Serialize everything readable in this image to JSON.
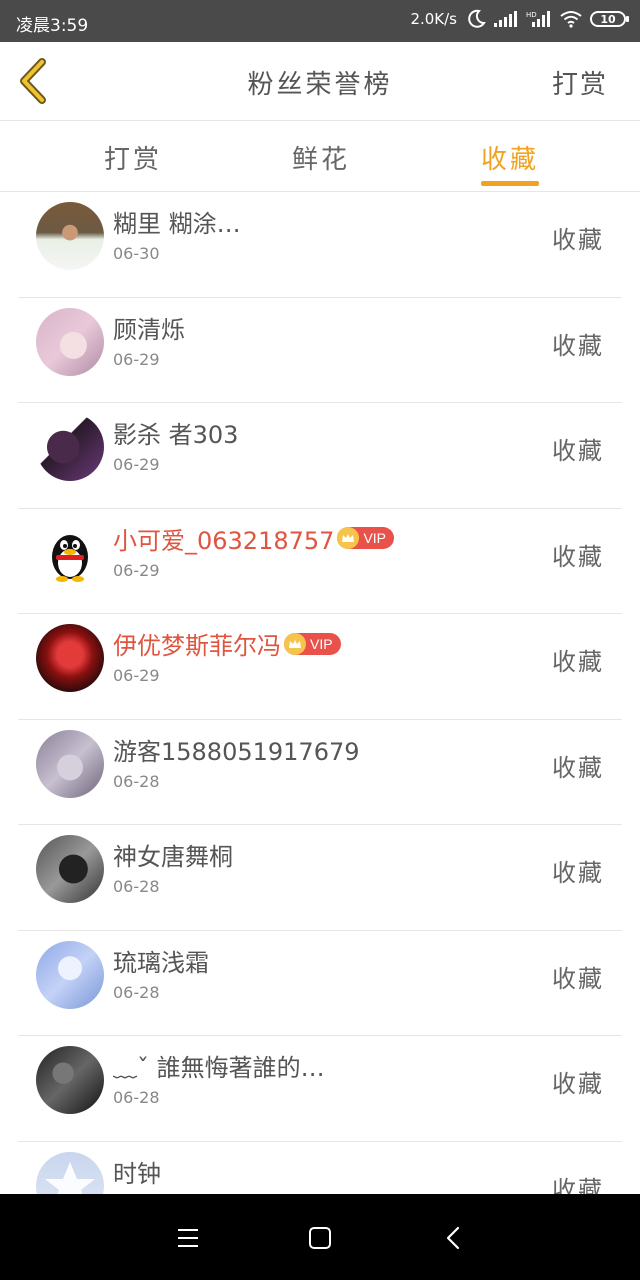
{
  "status_bar": {
    "time": "凌晨3:59",
    "net_speed": "2.0K/s",
    "battery": "10"
  },
  "header": {
    "title": "粉丝荣誉榜",
    "action_label": "打赏"
  },
  "tabs": [
    {
      "label": "打赏",
      "active": false
    },
    {
      "label": "鲜花",
      "active": false
    },
    {
      "label": "收藏",
      "active": true
    }
  ],
  "colors": {
    "accent": "#f0a323",
    "vip_name": "#e0553f",
    "vip_badge": "#e9524a"
  },
  "vip_badge_text": "VIP",
  "list": [
    {
      "name": "糊里 糊涂…",
      "date": "06-30",
      "type": "收藏",
      "vip": false
    },
    {
      "name": "顾清烁",
      "date": "06-29",
      "type": "收藏",
      "vip": false
    },
    {
      "name": "影杀 者303",
      "date": "06-29",
      "type": "收藏",
      "vip": false
    },
    {
      "name": "小可爱_063218757",
      "date": "06-29",
      "type": "收藏",
      "vip": true
    },
    {
      "name": "伊优梦斯菲尔冯",
      "date": "06-29",
      "type": "收藏",
      "vip": true
    },
    {
      "name": "游客1588051917679",
      "date": "06-28",
      "type": "收藏",
      "vip": false
    },
    {
      "name": "神女唐舞桐",
      "date": "06-28",
      "type": "收藏",
      "vip": false
    },
    {
      "name": "琉璃浅霜",
      "date": "06-28",
      "type": "收藏",
      "vip": false
    },
    {
      "name": "﹏ˇ 誰無悔著誰的…",
      "date": "06-28",
      "type": "收藏",
      "vip": false
    },
    {
      "name": "时钟",
      "date": "",
      "type": "收藏",
      "vip": false
    }
  ],
  "icons": {
    "back": "chevron-left-icon",
    "system_nav": [
      "menu-icon",
      "home-icon",
      "back-icon"
    ]
  }
}
